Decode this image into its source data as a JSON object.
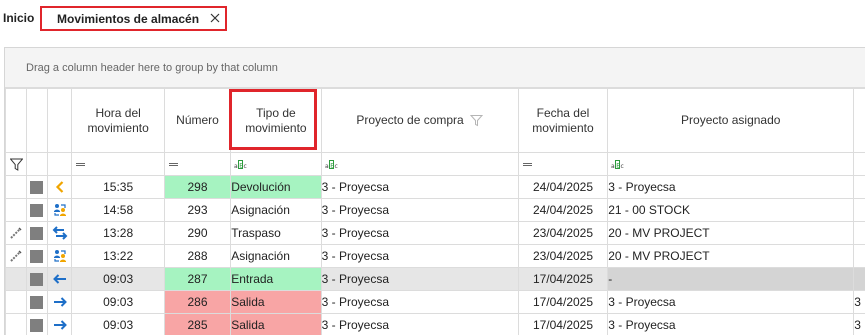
{
  "header": {
    "home_label": "Inicio",
    "tab_label": "Movimientos de almacén"
  },
  "grid": {
    "group_hint": "Drag a column header here to group by that column",
    "columns": {
      "hora": "Hora del movimiento",
      "numero": "Número",
      "tipo": "Tipo de movimiento",
      "proyecto_compra": "Proyecto de compra",
      "fecha": "Fecha del movimiento",
      "proyecto_asignado": "Proyecto asignado"
    },
    "rows": [
      {
        "icon": "chevron-left-icon",
        "hora": "15:35",
        "numero": "298",
        "tipo": "Devolución",
        "proyecto_compra": "3 - Proyecsa",
        "fecha": "24/04/2025",
        "proyecto_asignado": "3 - Proyecsa",
        "extra": ""
      },
      {
        "icon": "assign-icon",
        "hora": "14:58",
        "numero": "293",
        "tipo": "Asignación",
        "proyecto_compra": "3 - Proyecsa",
        "fecha": "24/04/2025",
        "proyecto_asignado": "21 - 00 STOCK",
        "extra": ""
      },
      {
        "icon": "transfer-icon",
        "hora": "13:28",
        "numero": "290",
        "tipo": "Traspaso",
        "proyecto_compra": "3 - Proyecsa",
        "fecha": "23/04/2025",
        "proyecto_asignado": "20 - MV PROJECT",
        "extra": ""
      },
      {
        "icon": "assign-icon",
        "hora": "13:22",
        "numero": "288",
        "tipo": "Asignación",
        "proyecto_compra": "3 - Proyecsa",
        "fecha": "23/04/2025",
        "proyecto_asignado": "20 - MV PROJECT",
        "extra": ""
      },
      {
        "icon": "arrow-left-icon",
        "hora": "09:03",
        "numero": "287",
        "tipo": "Entrada",
        "proyecto_compra": "3 - Proyecsa",
        "fecha": "17/04/2025",
        "proyecto_asignado": "-",
        "extra": ""
      },
      {
        "icon": "arrow-right-icon",
        "hora": "09:03",
        "numero": "286",
        "tipo": "Salida",
        "proyecto_compra": "3 - Proyecsa",
        "fecha": "17/04/2025",
        "proyecto_asignado": "3 - Proyecsa",
        "extra": "3"
      },
      {
        "icon": "arrow-right-icon",
        "hora": "09:03",
        "numero": "285",
        "tipo": "Salida",
        "proyecto_compra": "3 - Proyecsa",
        "fecha": "17/04/2025",
        "proyecto_asignado": "3 - Proyecsa",
        "extra": "3"
      }
    ]
  },
  "colors": {
    "highlight_border": "#e0252b",
    "devolucion_bg": "#a6f3c1",
    "entrada_bg": "#a6f3c1",
    "salida_bg": "#f8a5a5",
    "icon_blue": "#1e6fc8",
    "icon_orange": "#f0a500"
  }
}
